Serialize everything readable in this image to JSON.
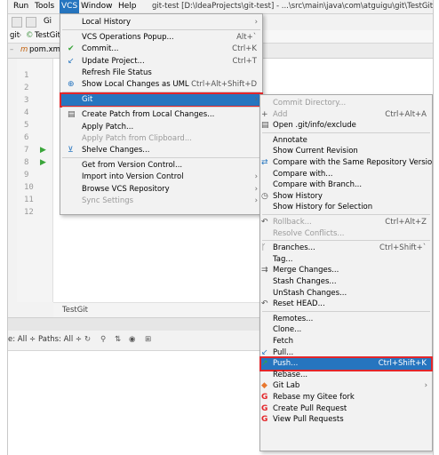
{
  "menubar": {
    "items": [
      "Run",
      "Tools",
      "VCS",
      "Window",
      "Help"
    ],
    "title": "git-test [D:\\IdeaProjects\\git-test] - ...\\src\\main\\java\\com\\atguigu\\git\\TestGit.java - Int"
  },
  "toolbar": {
    "branch_fragment": "Gi"
  },
  "breadcrumb": {
    "project": "git",
    "file": "TestGit"
  },
  "tabs": {
    "file": "pom.xm"
  },
  "editor": {
    "line_numbers": [
      "1",
      "2",
      "3",
      "4",
      "5",
      "6",
      "7",
      "8",
      "9",
      "10",
      "11",
      "12"
    ],
    "footer_label": "TestGit"
  },
  "filter": {
    "label1": "e: All ÷",
    "label2": "Paths: All ÷"
  },
  "vcs_menu": [
    {
      "label": "Local History",
      "shortcut": "",
      "submenu": true,
      "enabled": true,
      "icon": ""
    },
    {
      "sep": true
    },
    {
      "label": "VCS Operations Popup...",
      "shortcut": "Alt+`",
      "enabled": true,
      "icon": ""
    },
    {
      "label": "Commit...",
      "shortcut": "Ctrl+K",
      "enabled": true,
      "icon": "✔"
    },
    {
      "label": "Update Project...",
      "shortcut": "Ctrl+T",
      "enabled": true,
      "icon": "↙"
    },
    {
      "label": "Refresh File Status",
      "shortcut": "",
      "enabled": true,
      "icon": ""
    },
    {
      "label": "Show Local Changes as UML",
      "shortcut": "Ctrl+Alt+Shift+D",
      "enabled": true,
      "icon": "⊕"
    },
    {
      "sep": true
    },
    {
      "label": "Git",
      "shortcut": "",
      "submenu": true,
      "enabled": true,
      "selected": true,
      "icon": ""
    },
    {
      "sep": true
    },
    {
      "label": "Create Patch from Local Changes...",
      "shortcut": "",
      "enabled": true,
      "icon": "▤"
    },
    {
      "label": "Apply Patch...",
      "shortcut": "",
      "enabled": true,
      "icon": ""
    },
    {
      "label": "Apply Patch from Clipboard...",
      "shortcut": "",
      "enabled": false,
      "icon": ""
    },
    {
      "label": "Shelve Changes...",
      "shortcut": "",
      "enabled": true,
      "icon": "⊻"
    },
    {
      "sep": true
    },
    {
      "label": "Get from Version Control...",
      "shortcut": "",
      "enabled": true,
      "icon": ""
    },
    {
      "label": "Import into Version Control",
      "shortcut": "",
      "submenu": true,
      "enabled": true,
      "icon": ""
    },
    {
      "label": "Browse VCS Repository",
      "shortcut": "",
      "submenu": true,
      "enabled": true,
      "icon": ""
    },
    {
      "label": "Sync Settings",
      "shortcut": "",
      "submenu": true,
      "enabled": false,
      "icon": ""
    }
  ],
  "git_menu": [
    {
      "label": "Commit Directory...",
      "shortcut": "",
      "enabled": false,
      "icon": ""
    },
    {
      "label": "Add",
      "shortcut": "Ctrl+Alt+A",
      "enabled": false,
      "icon": "+"
    },
    {
      "label": "Open .git/info/exclude",
      "shortcut": "",
      "enabled": true,
      "icon": "▤"
    },
    {
      "sep": true
    },
    {
      "label": "Annotate",
      "shortcut": "",
      "enabled": true,
      "icon": ""
    },
    {
      "label": "Show Current Revision",
      "shortcut": "",
      "enabled": true,
      "icon": ""
    },
    {
      "label": "Compare with the Same Repository Version",
      "shortcut": "",
      "enabled": true,
      "icon": "⇄"
    },
    {
      "label": "Compare with...",
      "shortcut": "",
      "enabled": true,
      "icon": ""
    },
    {
      "label": "Compare with Branch...",
      "shortcut": "",
      "enabled": true,
      "icon": ""
    },
    {
      "label": "Show History",
      "shortcut": "",
      "enabled": true,
      "icon": "◷"
    },
    {
      "label": "Show History for Selection",
      "shortcut": "",
      "enabled": true,
      "icon": ""
    },
    {
      "sep": true
    },
    {
      "label": "Rollback...",
      "shortcut": "Ctrl+Alt+Z",
      "enabled": false,
      "icon": "↶"
    },
    {
      "label": "Resolve Conflicts...",
      "shortcut": "",
      "enabled": false,
      "icon": ""
    },
    {
      "sep": true
    },
    {
      "label": "Branches...",
      "shortcut": "Ctrl+Shift+`",
      "enabled": true,
      "icon": "ᚴ"
    },
    {
      "label": "Tag...",
      "shortcut": "",
      "enabled": true,
      "icon": ""
    },
    {
      "label": "Merge Changes...",
      "shortcut": "",
      "enabled": true,
      "icon": "⇉"
    },
    {
      "label": "Stash Changes...",
      "shortcut": "",
      "enabled": true,
      "icon": ""
    },
    {
      "label": "UnStash Changes...",
      "shortcut": "",
      "enabled": true,
      "icon": ""
    },
    {
      "label": "Reset HEAD...",
      "shortcut": "",
      "enabled": true,
      "icon": "↶"
    },
    {
      "sep": true
    },
    {
      "label": "Remotes...",
      "shortcut": "",
      "enabled": true,
      "icon": ""
    },
    {
      "label": "Clone...",
      "shortcut": "",
      "enabled": true,
      "icon": ""
    },
    {
      "label": "Fetch",
      "shortcut": "",
      "enabled": true,
      "icon": ""
    },
    {
      "label": "Pull...",
      "shortcut": "",
      "enabled": true,
      "icon": "↙"
    },
    {
      "label": "Push...",
      "shortcut": "Ctrl+Shift+K",
      "enabled": true,
      "selected": true,
      "icon": "↗"
    },
    {
      "label": "Rebase...",
      "shortcut": "",
      "enabled": true,
      "icon": ""
    },
    {
      "label": "Git Lab",
      "shortcut": "",
      "submenu": true,
      "enabled": true,
      "icon": "◆"
    },
    {
      "label": "Rebase my Gitee fork",
      "shortcut": "",
      "enabled": true,
      "icon": "G"
    },
    {
      "label": "Create Pull Request",
      "shortcut": "",
      "enabled": true,
      "icon": "G"
    },
    {
      "label": "View Pull Requests",
      "shortcut": "",
      "enabled": true,
      "icon": "G"
    }
  ],
  "colors": {
    "selection": "#2675bf",
    "highlight_box": "#e3262a",
    "gitee": "#e3262a",
    "gitlab": "#e8772e"
  }
}
